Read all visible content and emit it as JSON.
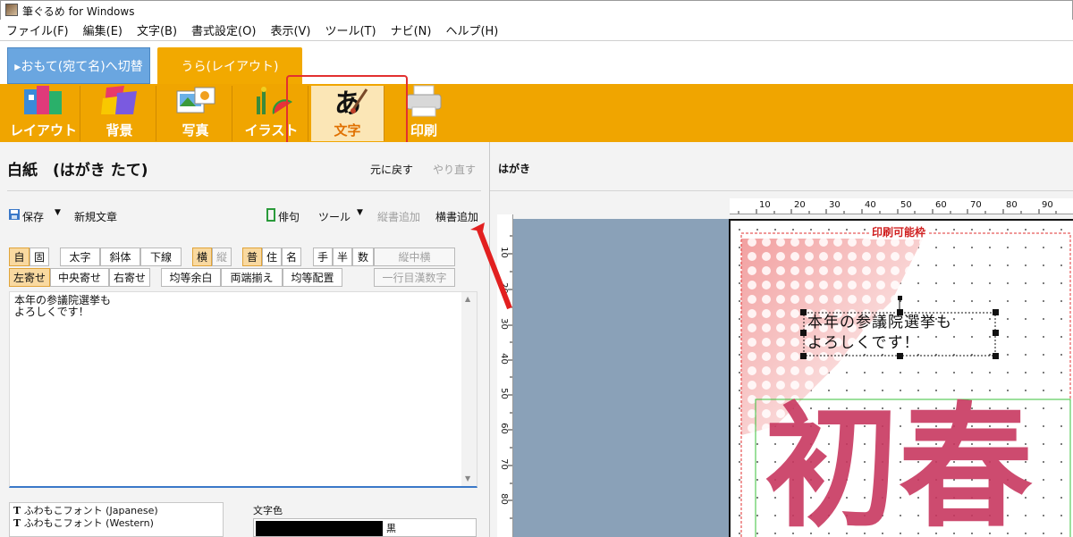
{
  "window": {
    "title": "筆ぐるめ for Windows"
  },
  "menu": [
    "ファイル(F)",
    "編集(E)",
    "文字(B)",
    "書式設定(O)",
    "表示(V)",
    "ツール(T)",
    "ナビ(N)",
    "ヘルプ(H)"
  ],
  "tabs": {
    "front": "▸おもて(宛て名)へ切替",
    "back": "うら(レイアウト)"
  },
  "ribbon": [
    {
      "label": "レイアウト",
      "icon": "layout-books-icon"
    },
    {
      "label": "背景",
      "icon": "background-paper-icon"
    },
    {
      "label": "写真",
      "icon": "photo-icon"
    },
    {
      "label": "イラスト",
      "icon": "illustration-icon"
    },
    {
      "label": "文字",
      "icon": "brush-character-icon"
    },
    {
      "label": "印刷",
      "icon": "printer-icon"
    }
  ],
  "editor": {
    "title": "白紙　(はがき たて)",
    "undo": "元に戻す",
    "redo": "やり直す",
    "save": "保存",
    "new_text": "新規文章",
    "haiku": "俳句",
    "tools": "ツール",
    "add_vertical": "縦書追加",
    "add_horizontal": "横書追加",
    "row1": {
      "free": "自",
      "fixed": "固",
      "bold": "太字",
      "italic": "斜体",
      "underline": "下線",
      "horizontal": "横",
      "vertical": "縦",
      "normal": "普",
      "address": "住",
      "name": "名",
      "hand": "手",
      "half": "半",
      "digit": "数",
      "tate_chu_yoko": "縦中横"
    },
    "row2": {
      "left": "左寄せ",
      "center": "中央寄せ",
      "right": "右寄せ",
      "even_space": "均等余白",
      "justify": "両端揃え",
      "distribute": "均等配置",
      "kanji_digits": "一行目漢数字"
    },
    "text": "本年の参議院選挙も\nよろしくです！",
    "fonts": [
      "ふわもこフォント (Japanese)",
      "ふわもこフォント (Western)"
    ],
    "color_label": "文字色",
    "color_name": "黒"
  },
  "preview": {
    "label": "はがき",
    "print_area": "印刷可能枠",
    "textbox": [
      "本年の参議院選挙も",
      "よろしくです！"
    ],
    "big_text": "初春"
  },
  "ruler_h": [
    "10",
    "20",
    "30",
    "40",
    "50",
    "60",
    "70",
    "80",
    "90"
  ],
  "ruler_v": [
    "10",
    "20",
    "30",
    "40",
    "50",
    "60",
    "70",
    "80"
  ],
  "colors": {
    "ribbon": "#f0a500",
    "tab_front": "#6aa6e0",
    "active_bg": "#fbe6b6",
    "highlight": "#e23030",
    "canvas": "#8aa1b8"
  }
}
